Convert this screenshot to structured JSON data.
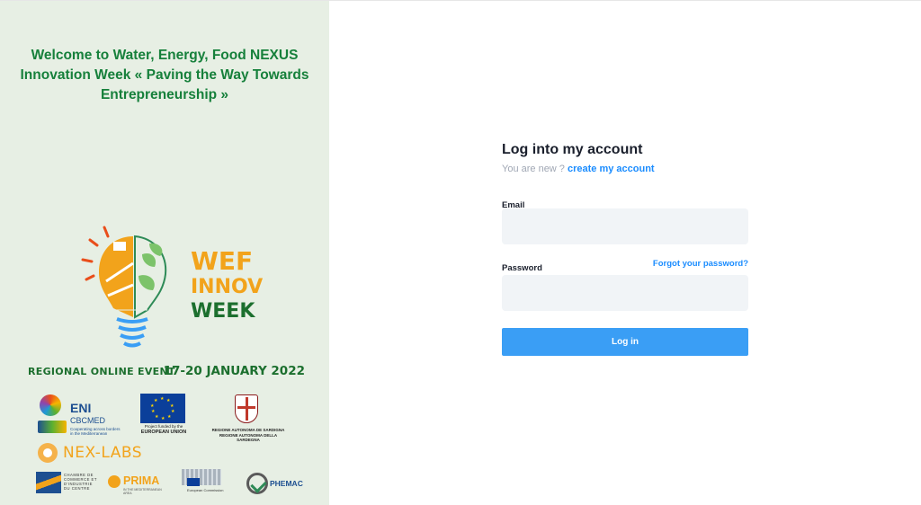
{
  "left_panel": {
    "welcome_text": "Welcome to Water, Energy, Food NEXUS Innovation Week « Paving the Way Towards Entrepreneurship »",
    "wef_logo": {
      "line1": "WEF",
      "line2": "INNOV",
      "line3": "WEEK"
    },
    "event_label": "REGIONAL ONLINE EVENT",
    "event_dates": "17-20 JANUARY 2022",
    "partners": {
      "eni": {
        "title": "ENI",
        "subtitle": "CBCMED",
        "tagline": "Cooperating across borders in the Mediterranean"
      },
      "eu": {
        "caption": "Project funded by the",
        "caption_bold": "EUROPEAN UNION"
      },
      "sardegna": {
        "caption": "REGIONE AUTONOMA DE SARDIGNA REGIONE AUTONOMA DELLA SARDEGNA"
      },
      "nexlabs": {
        "name": "NEX-LABS"
      },
      "ccic": {
        "text": "CHAMBRE DE COMMERCE ET D'INDUSTRIE DU CENTRE"
      },
      "prima": {
        "name": "PRIMA",
        "tagline": "IN THE MEDITERRANEAN AREA"
      },
      "ec": {
        "caption": "European Commission"
      },
      "phemac": {
        "name": "PHEMAC",
        "tagline": ""
      }
    },
    "colors": {
      "green": "#16803b",
      "orange": "#f2a31b",
      "panel_bg": "#e7efe4"
    }
  },
  "login": {
    "title": "Log into my account",
    "new_prefix": "You are new ?",
    "create_link": "create my account",
    "email_label": "Email",
    "email_value": "",
    "password_label": "Password",
    "forgot_link": "Forgot your password?",
    "password_value": "",
    "submit_label": "Log in",
    "colors": {
      "accent": "#1a8cff",
      "button": "#3a9ef5",
      "field_bg": "#f1f4f7"
    }
  }
}
